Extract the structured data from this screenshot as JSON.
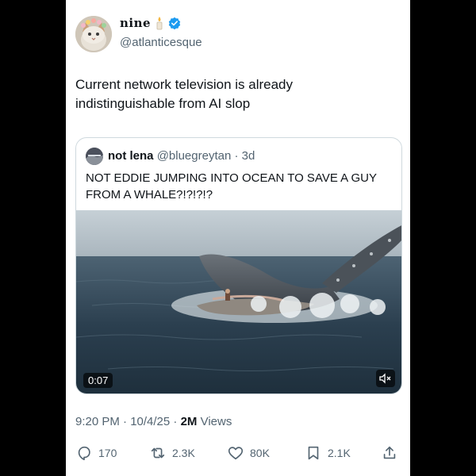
{
  "post": {
    "author": {
      "display_name": "nine",
      "handle": "@atlanticesque",
      "name_emoji": "candle-icon",
      "verified_icon": "verified-badge-icon"
    },
    "text": "Current network television is already indistinguishable from AI slop",
    "timestamp": "9:20 PM · 10/4/25 · ",
    "views_count": "2M",
    "views_label": " Views"
  },
  "quote": {
    "author": {
      "display_name": "not lena",
      "handle": "@bluegreytan",
      "separator": " · ",
      "age": "3d"
    },
    "text": "NOT EDDIE JUMPING INTO OCEAN TO SAVE A GUY FROM A WHALE?!?!?!?",
    "video": {
      "duration": "0:07",
      "mute_icon": "speaker-muted-icon"
    }
  },
  "actions": {
    "replies": "170",
    "reposts": "2.3K",
    "likes": "80K",
    "bookmarks": "2.1K"
  },
  "colors": {
    "text_primary": "#0f1419",
    "text_secondary": "#536471",
    "verified": "#1d9bf0",
    "border": "#cfd9de"
  }
}
